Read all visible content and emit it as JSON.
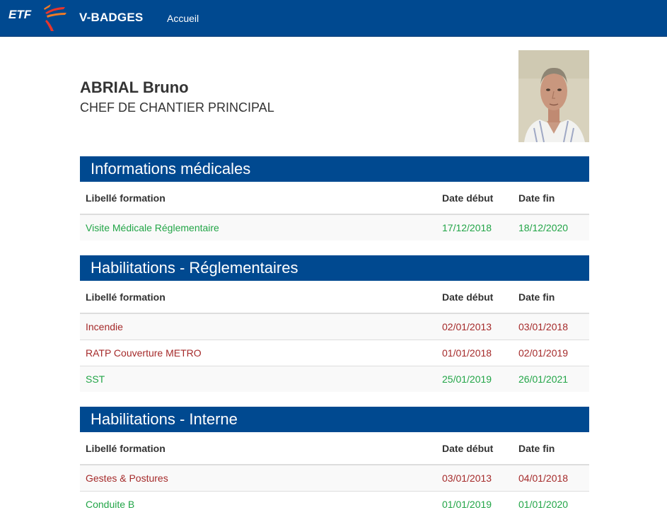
{
  "navbar": {
    "logo_text": "ETF",
    "app_name": "V-BADGES",
    "link_home": "Accueil",
    "brand_color": "#004990"
  },
  "profile": {
    "name": "ABRIAL Bruno",
    "job_title": "CHEF DE CHANTIER PRINCIPAL"
  },
  "columns": {
    "label": "Libellé formation",
    "start": "Date début",
    "end": "Date fin"
  },
  "colors": {
    "valid": "#22a547",
    "expired": "#a52a2a",
    "section_header": "#004990"
  },
  "sections": [
    {
      "title": "Informations médicales",
      "rows": [
        {
          "label": "Visite Médicale Réglementaire",
          "start": "17/12/2018",
          "end": "18/12/2020",
          "status": "valid"
        }
      ]
    },
    {
      "title": "Habilitations - Réglementaires",
      "rows": [
        {
          "label": "Incendie",
          "start": "02/01/2013",
          "end": "03/01/2018",
          "status": "expired"
        },
        {
          "label": "RATP Couverture METRO",
          "start": "01/01/2018",
          "end": "02/01/2019",
          "status": "expired"
        },
        {
          "label": "SST",
          "start": "25/01/2019",
          "end": "26/01/2021",
          "status": "valid"
        }
      ]
    },
    {
      "title": "Habilitations - Interne",
      "rows": [
        {
          "label": "Gestes & Postures",
          "start": "03/01/2013",
          "end": "04/01/2018",
          "status": "expired"
        },
        {
          "label": "Conduite B",
          "start": "01/01/2019",
          "end": "01/01/2020",
          "status": "valid"
        }
      ]
    }
  ]
}
